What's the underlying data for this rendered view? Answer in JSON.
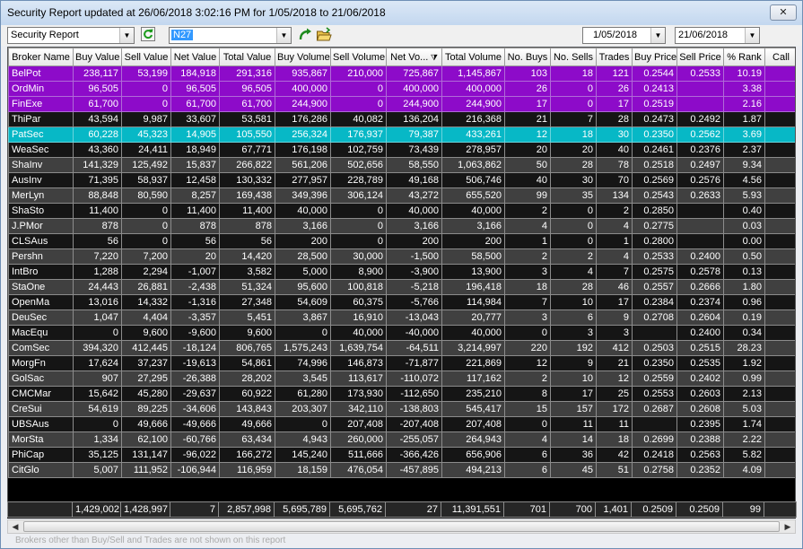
{
  "window": {
    "title": "Security Report updated at 26/06/2018 3:02:16 PM for 1/05/2018 to 21/06/2018",
    "close_label": "✕"
  },
  "toolbar": {
    "report_select": "Security Report",
    "security_code": "N27",
    "date_from": "1/05/2018",
    "date_to": "21/06/2018",
    "refresh_icon": "refresh-icon",
    "go_icon": "go-arrow-icon",
    "open_icon": "open-folder-icon"
  },
  "columns": [
    "Broker Name",
    "Buy Value",
    "Sell Value",
    "Net Value",
    "Total Value",
    "Buy Volume",
    "Sell Volume",
    "Net Vo...",
    "Total Volume",
    "No. Buys",
    "No. Sells",
    "Trades",
    "Buy Price",
    "Sell Price",
    "% Rank",
    "Call"
  ],
  "colors": {
    "purple": "#8d0bc9",
    "teal": "#07b8c6",
    "dark": "#404040",
    "black": "#151515"
  },
  "rows": [
    {
      "style": "purple",
      "cells": [
        "BelPot",
        "238,117",
        "53,199",
        "184,918",
        "291,316",
        "935,867",
        "210,000",
        "725,867",
        "1,145,867",
        "103",
        "18",
        "121",
        "0.2544",
        "0.2533",
        "10.19",
        ""
      ]
    },
    {
      "style": "purple",
      "cells": [
        "OrdMin",
        "96,505",
        "0",
        "96,505",
        "96,505",
        "400,000",
        "0",
        "400,000",
        "400,000",
        "26",
        "0",
        "26",
        "0.2413",
        "",
        "3.38",
        ""
      ]
    },
    {
      "style": "purple",
      "cells": [
        "FinExe",
        "61,700",
        "0",
        "61,700",
        "61,700",
        "244,900",
        "0",
        "244,900",
        "244,900",
        "17",
        "0",
        "17",
        "0.2519",
        "",
        "2.16",
        ""
      ]
    },
    {
      "style": "black",
      "cells": [
        "ThiPar",
        "43,594",
        "9,987",
        "33,607",
        "53,581",
        "176,286",
        "40,082",
        "136,204",
        "216,368",
        "21",
        "7",
        "28",
        "0.2473",
        "0.2492",
        "1.87",
        ""
      ]
    },
    {
      "style": "teal",
      "cells": [
        "PatSec",
        "60,228",
        "45,323",
        "14,905",
        "105,550",
        "256,324",
        "176,937",
        "79,387",
        "433,261",
        "12",
        "18",
        "30",
        "0.2350",
        "0.2562",
        "3.69",
        ""
      ]
    },
    {
      "style": "black",
      "cells": [
        "WeaSec",
        "43,360",
        "24,411",
        "18,949",
        "67,771",
        "176,198",
        "102,759",
        "73,439",
        "278,957",
        "20",
        "20",
        "40",
        "0.2461",
        "0.2376",
        "2.37",
        ""
      ]
    },
    {
      "style": "dark",
      "cells": [
        "ShaInv",
        "141,329",
        "125,492",
        "15,837",
        "266,822",
        "561,206",
        "502,656",
        "58,550",
        "1,063,862",
        "50",
        "28",
        "78",
        "0.2518",
        "0.2497",
        "9.34",
        ""
      ]
    },
    {
      "style": "black",
      "cells": [
        "AusInv",
        "71,395",
        "58,937",
        "12,458",
        "130,332",
        "277,957",
        "228,789",
        "49,168",
        "506,746",
        "40",
        "30",
        "70",
        "0.2569",
        "0.2576",
        "4.56",
        ""
      ]
    },
    {
      "style": "dark",
      "cells": [
        "MerLyn",
        "88,848",
        "80,590",
        "8,257",
        "169,438",
        "349,396",
        "306,124",
        "43,272",
        "655,520",
        "99",
        "35",
        "134",
        "0.2543",
        "0.2633",
        "5.93",
        ""
      ]
    },
    {
      "style": "black",
      "cells": [
        "ShaSto",
        "11,400",
        "0",
        "11,400",
        "11,400",
        "40,000",
        "0",
        "40,000",
        "40,000",
        "2",
        "0",
        "2",
        "0.2850",
        "",
        "0.40",
        ""
      ]
    },
    {
      "style": "dark",
      "cells": [
        "J.PMor",
        "878",
        "0",
        "878",
        "878",
        "3,166",
        "0",
        "3,166",
        "3,166",
        "4",
        "0",
        "4",
        "0.2775",
        "",
        "0.03",
        ""
      ]
    },
    {
      "style": "black",
      "cells": [
        "CLSAus",
        "56",
        "0",
        "56",
        "56",
        "200",
        "0",
        "200",
        "200",
        "1",
        "0",
        "1",
        "0.2800",
        "",
        "0.00",
        ""
      ]
    },
    {
      "style": "dark",
      "cells": [
        "Pershn",
        "7,220",
        "7,200",
        "20",
        "14,420",
        "28,500",
        "30,000",
        "-1,500",
        "58,500",
        "2",
        "2",
        "4",
        "0.2533",
        "0.2400",
        "0.50",
        ""
      ]
    },
    {
      "style": "black",
      "cells": [
        "IntBro",
        "1,288",
        "2,294",
        "-1,007",
        "3,582",
        "5,000",
        "8,900",
        "-3,900",
        "13,900",
        "3",
        "4",
        "7",
        "0.2575",
        "0.2578",
        "0.13",
        ""
      ]
    },
    {
      "style": "dark",
      "cells": [
        "StaOne",
        "24,443",
        "26,881",
        "-2,438",
        "51,324",
        "95,600",
        "100,818",
        "-5,218",
        "196,418",
        "18",
        "28",
        "46",
        "0.2557",
        "0.2666",
        "1.80",
        ""
      ]
    },
    {
      "style": "black",
      "cells": [
        "OpenMa",
        "13,016",
        "14,332",
        "-1,316",
        "27,348",
        "54,609",
        "60,375",
        "-5,766",
        "114,984",
        "7",
        "10",
        "17",
        "0.2384",
        "0.2374",
        "0.96",
        ""
      ]
    },
    {
      "style": "dark",
      "cells": [
        "DeuSec",
        "1,047",
        "4,404",
        "-3,357",
        "5,451",
        "3,867",
        "16,910",
        "-13,043",
        "20,777",
        "3",
        "6",
        "9",
        "0.2708",
        "0.2604",
        "0.19",
        ""
      ]
    },
    {
      "style": "black",
      "cells": [
        "MacEqu",
        "0",
        "9,600",
        "-9,600",
        "9,600",
        "0",
        "40,000",
        "-40,000",
        "40,000",
        "0",
        "3",
        "3",
        "",
        "0.2400",
        "0.34",
        ""
      ]
    },
    {
      "style": "dark",
      "cells": [
        "ComSec",
        "394,320",
        "412,445",
        "-18,124",
        "806,765",
        "1,575,243",
        "1,639,754",
        "-64,511",
        "3,214,997",
        "220",
        "192",
        "412",
        "0.2503",
        "0.2515",
        "28.23",
        ""
      ]
    },
    {
      "style": "black",
      "cells": [
        "MorgFn",
        "17,624",
        "37,237",
        "-19,613",
        "54,861",
        "74,996",
        "146,873",
        "-71,877",
        "221,869",
        "12",
        "9",
        "21",
        "0.2350",
        "0.2535",
        "1.92",
        ""
      ]
    },
    {
      "style": "dark",
      "cells": [
        "GolSac",
        "907",
        "27,295",
        "-26,388",
        "28,202",
        "3,545",
        "113,617",
        "-110,072",
        "117,162",
        "2",
        "10",
        "12",
        "0.2559",
        "0.2402",
        "0.99",
        ""
      ]
    },
    {
      "style": "black",
      "cells": [
        "CMCMar",
        "15,642",
        "45,280",
        "-29,637",
        "60,922",
        "61,280",
        "173,930",
        "-112,650",
        "235,210",
        "8",
        "17",
        "25",
        "0.2553",
        "0.2603",
        "2.13",
        ""
      ]
    },
    {
      "style": "dark",
      "cells": [
        "CreSui",
        "54,619",
        "89,225",
        "-34,606",
        "143,843",
        "203,307",
        "342,110",
        "-138,803",
        "545,417",
        "15",
        "157",
        "172",
        "0.2687",
        "0.2608",
        "5.03",
        ""
      ]
    },
    {
      "style": "black",
      "cells": [
        "UBSAus",
        "0",
        "49,666",
        "-49,666",
        "49,666",
        "0",
        "207,408",
        "-207,408",
        "207,408",
        "0",
        "11",
        "11",
        "",
        "0.2395",
        "1.74",
        ""
      ]
    },
    {
      "style": "dark",
      "cells": [
        "MorSta",
        "1,334",
        "62,100",
        "-60,766",
        "63,434",
        "4,943",
        "260,000",
        "-255,057",
        "264,943",
        "4",
        "14",
        "18",
        "0.2699",
        "0.2388",
        "2.22",
        ""
      ]
    },
    {
      "style": "black",
      "cells": [
        "PhiCap",
        "35,125",
        "131,147",
        "-96,022",
        "166,272",
        "145,240",
        "511,666",
        "-366,426",
        "656,906",
        "6",
        "36",
        "42",
        "0.2418",
        "0.2563",
        "5.82",
        ""
      ]
    },
    {
      "style": "dark",
      "cells": [
        "CitGlo",
        "5,007",
        "111,952",
        "-106,944",
        "116,959",
        "18,159",
        "476,054",
        "-457,895",
        "494,213",
        "6",
        "45",
        "51",
        "0.2758",
        "0.2352",
        "4.09",
        ""
      ]
    }
  ],
  "totals": [
    "",
    "1,429,002",
    "1,428,997",
    "7",
    "2,857,998",
    "5,695,789",
    "5,695,762",
    "27",
    "11,391,551",
    "701",
    "700",
    "1,401",
    "0.2509",
    "0.2509",
    "99",
    ""
  ],
  "status_text": "Brokers other than Buy/Sell and Trades are not shown on this report"
}
